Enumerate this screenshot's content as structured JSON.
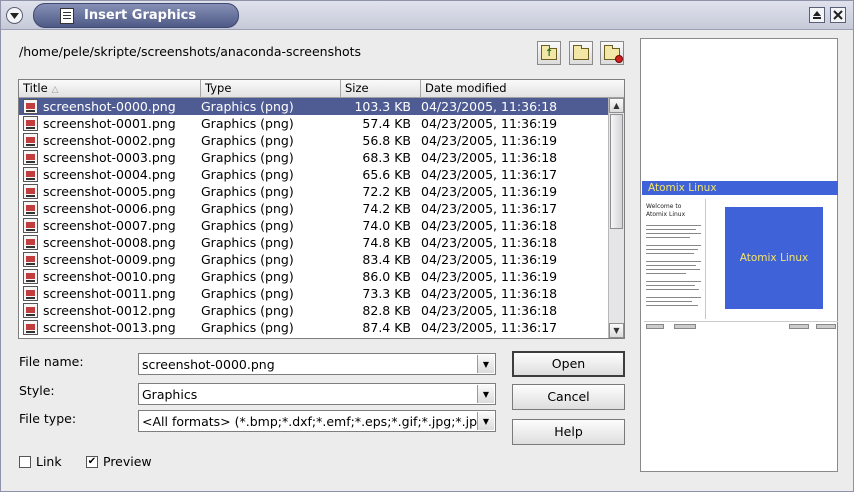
{
  "window": {
    "title": "Insert Graphics"
  },
  "path": "/home/pele/skripte/screenshots/anaconda-screenshots",
  "columns": {
    "title": "Title",
    "type": "Type",
    "size": "Size",
    "date": "Date modified"
  },
  "files": [
    {
      "name": "screenshot-0000.png",
      "type": "Graphics (png)",
      "size": "103.3 KB",
      "date": "04/23/2005, 11:36:18"
    },
    {
      "name": "screenshot-0001.png",
      "type": "Graphics (png)",
      "size": "57.4 KB",
      "date": "04/23/2005, 11:36:19"
    },
    {
      "name": "screenshot-0002.png",
      "type": "Graphics (png)",
      "size": "56.8 KB",
      "date": "04/23/2005, 11:36:19"
    },
    {
      "name": "screenshot-0003.png",
      "type": "Graphics (png)",
      "size": "68.3 KB",
      "date": "04/23/2005, 11:36:18"
    },
    {
      "name": "screenshot-0004.png",
      "type": "Graphics (png)",
      "size": "65.6 KB",
      "date": "04/23/2005, 11:36:17"
    },
    {
      "name": "screenshot-0005.png",
      "type": "Graphics (png)",
      "size": "72.2 KB",
      "date": "04/23/2005, 11:36:19"
    },
    {
      "name": "screenshot-0006.png",
      "type": "Graphics (png)",
      "size": "74.2 KB",
      "date": "04/23/2005, 11:36:17"
    },
    {
      "name": "screenshot-0007.png",
      "type": "Graphics (png)",
      "size": "74.0 KB",
      "date": "04/23/2005, 11:36:18"
    },
    {
      "name": "screenshot-0008.png",
      "type": "Graphics (png)",
      "size": "74.8 KB",
      "date": "04/23/2005, 11:36:18"
    },
    {
      "name": "screenshot-0009.png",
      "type": "Graphics (png)",
      "size": "83.4 KB",
      "date": "04/23/2005, 11:36:19"
    },
    {
      "name": "screenshot-0010.png",
      "type": "Graphics (png)",
      "size": "86.0 KB",
      "date": "04/23/2005, 11:36:19"
    },
    {
      "name": "screenshot-0011.png",
      "type": "Graphics (png)",
      "size": "73.3 KB",
      "date": "04/23/2005, 11:36:18"
    },
    {
      "name": "screenshot-0012.png",
      "type": "Graphics (png)",
      "size": "82.8 KB",
      "date": "04/23/2005, 11:36:18"
    },
    {
      "name": "screenshot-0013.png",
      "type": "Graphics (png)",
      "size": "87.4 KB",
      "date": "04/23/2005, 11:36:17"
    }
  ],
  "selected_index": 0,
  "form": {
    "file_name_label": "File name:",
    "file_name_value": "screenshot-0000.png",
    "style_label": "Style:",
    "style_value": "Graphics",
    "file_type_label": "File type:",
    "file_type_value": "<All formats> (*.bmp;*.dxf;*.emf;*.eps;*.gif;*.jpg;*.jpeg;*.jfif;"
  },
  "buttons": {
    "open": "Open",
    "cancel": "Cancel",
    "help": "Help"
  },
  "options": {
    "link_label": "Link",
    "link_checked": false,
    "preview_label": "Preview",
    "preview_checked": true
  },
  "preview": {
    "header_text": "Atomix Linux",
    "side_title": "Welcome to Atomix Linux",
    "main_text": "Atomix Linux"
  },
  "colors": {
    "selection": "#4f5b93",
    "titlebar_accent": "#4e5a86",
    "preview_blue": "#4062d8",
    "preview_text": "#f2e46a"
  },
  "icons": {
    "window_menu": "chevron-down-icon",
    "title": "document-icon",
    "maximize": "maximize-icon",
    "close": "close-icon",
    "parent_folder": "folder-up-icon",
    "new_folder": "folder-new-icon",
    "delete": "folder-delete-icon",
    "file": "image-file-icon"
  }
}
